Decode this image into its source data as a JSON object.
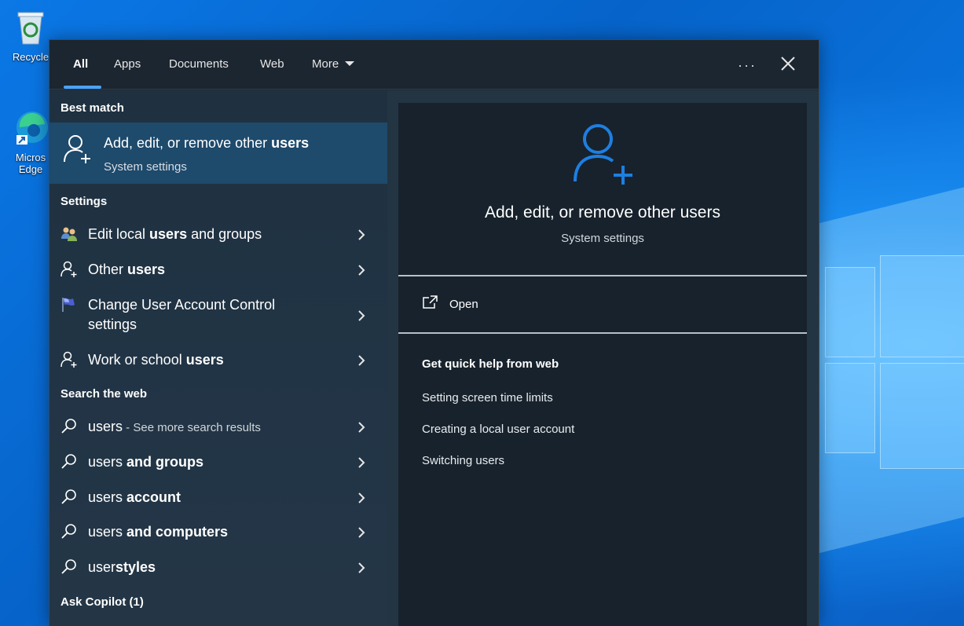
{
  "desktop": {
    "icons": [
      {
        "name": "recycle-bin",
        "label": "Recycle"
      },
      {
        "name": "edge",
        "label": "Micros Edge"
      }
    ]
  },
  "tabs": {
    "items": [
      "All",
      "Apps",
      "Documents",
      "Web"
    ],
    "more_label": "More",
    "active": "All",
    "overflow_icon": "more-dots-icon",
    "close_icon": "close-icon"
  },
  "left": {
    "best_match_header": "Best match",
    "best_match": {
      "title_prefix": "Add, edit, or remove other ",
      "title_bold": "users",
      "subtitle": "System settings"
    },
    "settings_header": "Settings",
    "settings": [
      {
        "pre": "Edit local ",
        "bold": "users",
        "post": " and groups",
        "icon": "users-group-icon"
      },
      {
        "pre": "Other ",
        "bold": "users",
        "post": "",
        "icon": "add-user-icon"
      },
      {
        "pre": "Change User Account Control",
        "bold": "",
        "post": "",
        "line2": "settings",
        "icon": "uac-flag-icon"
      },
      {
        "pre": "Work or school ",
        "bold": "users",
        "post": "",
        "icon": "add-user-icon"
      }
    ],
    "web_header": "Search the web",
    "web": [
      {
        "pre": "users",
        "bold": "",
        "sub": " - See more search results"
      },
      {
        "pre": "users",
        "bold": " and groups",
        "sub": ""
      },
      {
        "pre": "users",
        "bold": " account",
        "sub": ""
      },
      {
        "pre": "users",
        "bold": " and computers",
        "sub": ""
      },
      {
        "pre": "user",
        "bold": "styles",
        "sub": ""
      }
    ],
    "copilot_header": "Ask Copilot (1)"
  },
  "right": {
    "title": "Add, edit, or remove other users",
    "subtitle": "System settings",
    "open_label": "Open",
    "help_header": "Get quick help from web",
    "help_links": [
      "Setting screen time limits",
      "Creating a local user account",
      "Switching users"
    ]
  },
  "colors": {
    "accent": "#4aa3ff",
    "selected": "#1e4a6c",
    "panel": "#202b35",
    "icon_blue": "#1e7fe0"
  }
}
